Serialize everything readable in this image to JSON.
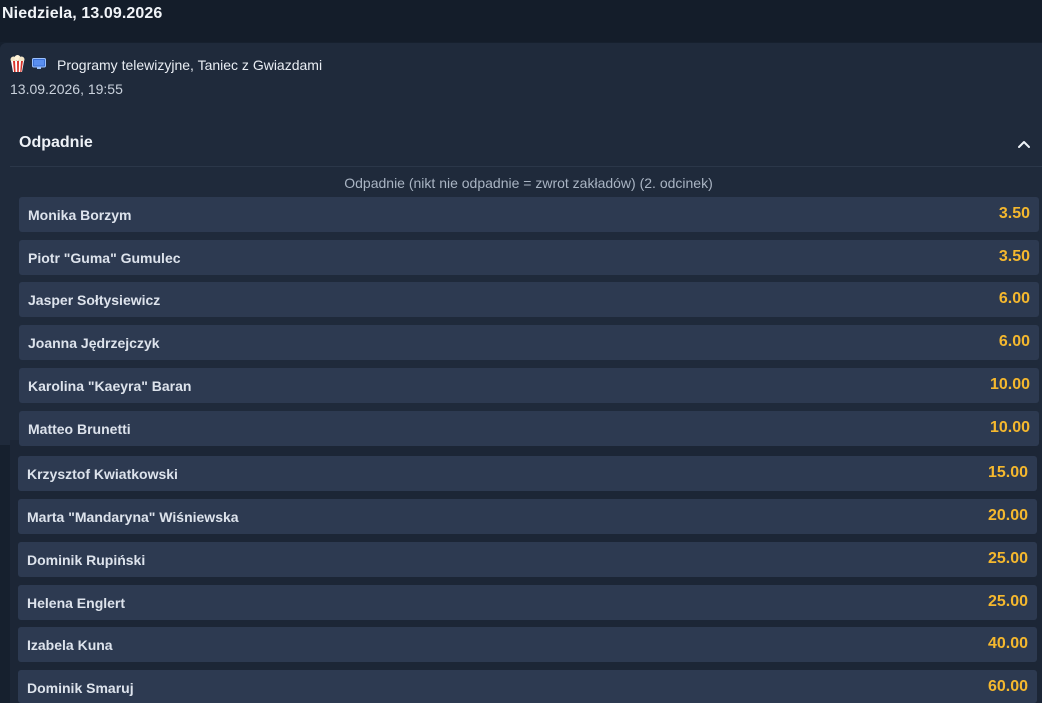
{
  "date_header": "Niedziela, 13.09.2026",
  "event": {
    "icons": [
      "popcorn-icon",
      "tv-icon"
    ],
    "name": "Programy telewizyjne, Taniec z Gwiazdami",
    "datetime": "13.09.2026, 19:55"
  },
  "market": {
    "title": "Odpadnie",
    "expanded": true,
    "subtitle": "Odpadnie (nikt nie odpadnie = zwrot zakładów) (2. odcinek)",
    "selections": [
      {
        "name": "Monika Borzym",
        "odds": "3.50"
      },
      {
        "name": "Piotr \"Guma\" Gumulec",
        "odds": "3.50"
      },
      {
        "name": "Jasper Sołtysiewicz",
        "odds": "6.00"
      },
      {
        "name": "Joanna Jędrzejczyk",
        "odds": "6.00"
      },
      {
        "name": "Karolina \"Kaeyra\" Baran",
        "odds": "10.00"
      },
      {
        "name": "Matteo Brunetti",
        "odds": "10.00"
      },
      {
        "name": "Krzysztof Kwiatkowski",
        "odds": "15.00"
      },
      {
        "name": "Marta \"Mandaryna\" Wiśniewska",
        "odds": "20.00"
      },
      {
        "name": "Dominik Rupiński",
        "odds": "25.00"
      },
      {
        "name": "Helena Englert",
        "odds": "25.00"
      },
      {
        "name": "Izabela Kuna",
        "odds": "40.00"
      },
      {
        "name": "Dominik Smaruj",
        "odds": "60.00"
      }
    ]
  },
  "colors": {
    "background": "#16202e",
    "card": "#1f2a3b",
    "row": "#2d3a51",
    "odds": "#f5b82e"
  }
}
